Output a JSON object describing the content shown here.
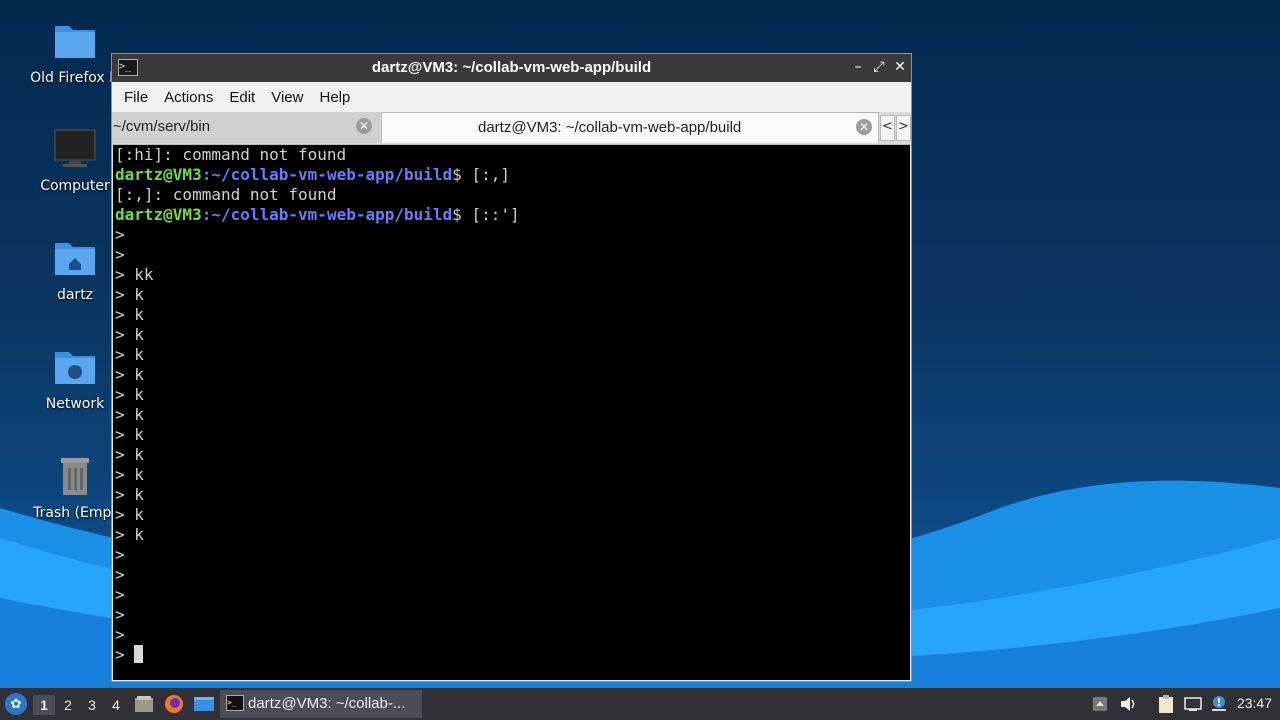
{
  "desktop": {
    "icons": [
      {
        "label": "Old Firefox D",
        "icon": "folder-icon"
      },
      {
        "label": "Computer",
        "icon": "computer-icon"
      },
      {
        "label": "dartz",
        "icon": "home-folder-icon"
      },
      {
        "label": "Network",
        "icon": "network-folder-icon"
      },
      {
        "label": "Trash (Empt",
        "icon": "trash-icon"
      }
    ]
  },
  "window": {
    "title": "dartz@VM3: ~/collab-vm-web-app/build",
    "controls": {
      "minimize": "–",
      "maximize": "⤢",
      "close": "✕"
    },
    "menu": [
      "File",
      "Actions",
      "Edit",
      "View",
      "Help"
    ],
    "tabs": [
      {
        "label": "~/cvm/serv/bin",
        "active": false
      },
      {
        "label": "dartz@VM3: ~/collab-vm-web-app/build",
        "active": true
      }
    ],
    "tab_scroll": {
      "left": "<",
      "right": ">"
    }
  },
  "terminal": {
    "colors": {
      "user": "#6ee040",
      "path": "#6b7bff",
      "text": "#d0d0d0",
      "background": "#000000"
    },
    "prompt_user": "dartz@VM3",
    "prompt_path": "~/collab-vm-web-app/build",
    "lines": [
      {
        "type": "out",
        "text": "[:hi]: command not found"
      },
      {
        "type": "prompt",
        "cmd": "$ [:,]"
      },
      {
        "type": "out",
        "text": "[:,]: command not found"
      },
      {
        "type": "prompt",
        "cmd": "$ [::']"
      },
      {
        "type": "out",
        "text": ">"
      },
      {
        "type": "out",
        "text": ">"
      },
      {
        "type": "out",
        "text": "> kk"
      },
      {
        "type": "out",
        "text": "> k"
      },
      {
        "type": "out",
        "text": "> k"
      },
      {
        "type": "out",
        "text": "> k"
      },
      {
        "type": "out",
        "text": "> k"
      },
      {
        "type": "out",
        "text": "> k"
      },
      {
        "type": "out",
        "text": "> k"
      },
      {
        "type": "out",
        "text": "> k"
      },
      {
        "type": "out",
        "text": "> k"
      },
      {
        "type": "out",
        "text": "> k"
      },
      {
        "type": "out",
        "text": "> k"
      },
      {
        "type": "out",
        "text": "> k"
      },
      {
        "type": "out",
        "text": "> k"
      },
      {
        "type": "out",
        "text": "> k"
      },
      {
        "type": "out",
        "text": ">"
      },
      {
        "type": "out",
        "text": ">"
      },
      {
        "type": "out",
        "text": ">"
      },
      {
        "type": "out",
        "text": ">"
      },
      {
        "type": "out",
        "text": ">"
      },
      {
        "type": "cursor",
        "text": "> "
      }
    ]
  },
  "taskbar": {
    "workspaces": [
      "1",
      "2",
      "3",
      "4"
    ],
    "active_workspace": "1",
    "task_label": "dartz@VM3: ~/collab-...",
    "clock": "23:47"
  }
}
